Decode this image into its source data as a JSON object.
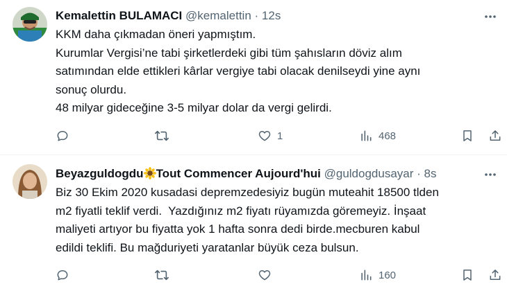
{
  "tweets": [
    {
      "display_name": "Kemalettin BULAMACI",
      "handle": "@kemalettin",
      "separator": "·",
      "time": "12s",
      "text_lines": [
        "KKM daha çıkmadan öneri yapmıştım.",
        "Kurumlar Vergisi’ne tabi şirketlerdeki gibi tüm şahısların döviz alım",
        "satımından elde ettikleri kârlar vergiye tabi olacak denilseydi yine aynı",
        "sonuç olurdu.",
        "48 milyar gideceğine 3-5 milyar dolar da vergi gelirdi."
      ],
      "replies": "",
      "retweets": "",
      "likes": "1",
      "views": "468"
    },
    {
      "display_name_part1": "Beyazguldogdu",
      "display_name_part2": "Tout Commencer Aujourd'hui",
      "handle": "@guldogdusayar",
      "separator": "·",
      "time": "8s",
      "text_lines": [
        "Biz 30 Ekim 2020 kusadasi depremzedesiyiz bugün muteahit 18500 tlden",
        "m2 fiyatli teklif verdi.  Yazdığınız m2 fiyatı rüyamızda göremeyiz. İnşaat",
        "maliyeti artıyor bu fiyatta yok 1 hafta sonra dedi birde.mecburen kabul",
        "edildi teklifi. Bu mağduriyeti yaratanlar büyük ceza bulsun."
      ],
      "replies": "",
      "retweets": "",
      "likes": "",
      "views": "160"
    }
  ],
  "icons": {
    "more": "more-horizontal-icon",
    "reply": "reply-icon",
    "retweet": "retweet-icon",
    "like": "heart-icon",
    "views": "views-icon",
    "bookmark": "bookmark-icon",
    "share": "share-icon",
    "emoji": "sunflower-emoji"
  },
  "colors": {
    "text": "#0f1419",
    "secondary": "#536471",
    "divider": "#eff3f4"
  }
}
